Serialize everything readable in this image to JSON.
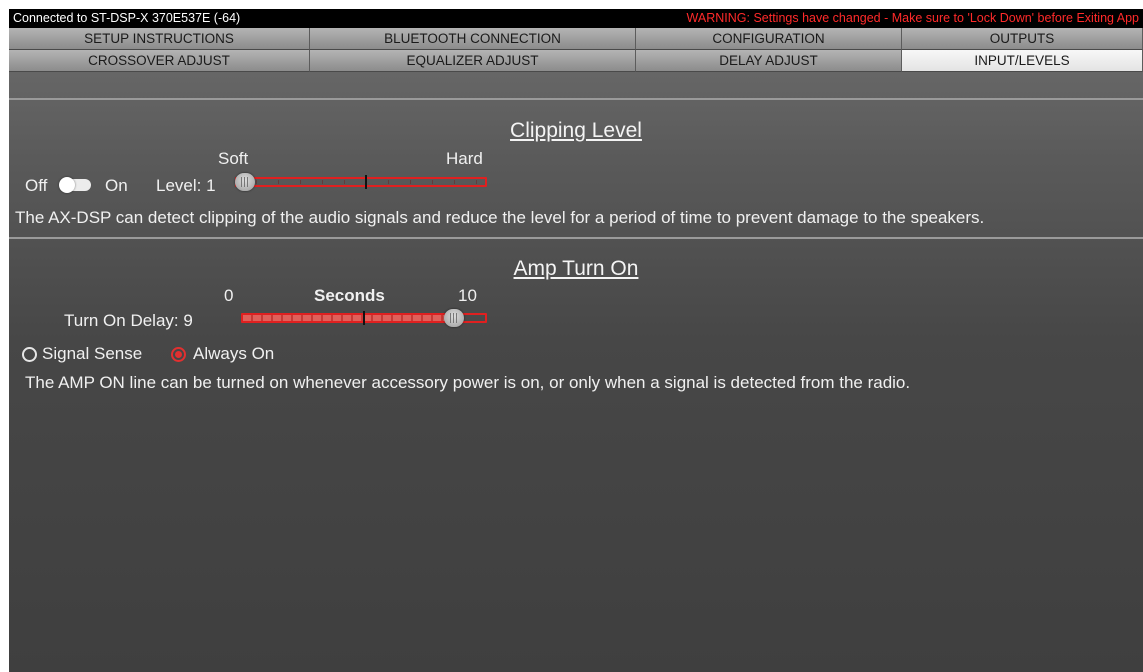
{
  "status": {
    "connection": "Connected to ST-DSP-X  370E537E (-64)",
    "warning": "WARNING: Settings have changed - Make sure to 'Lock Down' before Exiting App",
    "warning_color": "#ff2a2a"
  },
  "tabs_row1": [
    "SETUP INSTRUCTIONS",
    "BLUETOOTH CONNECTION",
    "CONFIGURATION",
    "OUTPUTS"
  ],
  "tabs_row2": [
    "CROSSOVER ADJUST",
    "EQUALIZER ADJUST",
    "DELAY ADJUST",
    "INPUT/LEVELS"
  ],
  "active_tab": "INPUT/LEVELS",
  "clipping": {
    "title": "Clipping Level",
    "soft_label": "Soft",
    "hard_label": "Hard",
    "off_label": "Off",
    "on_label": "On",
    "level_label": "Level: 1",
    "level_fraction": 0.0,
    "description": "The AX-DSP can detect clipping of the audio signals and reduce the level for a period of time to prevent damage to the speakers."
  },
  "amp": {
    "title": "Amp Turn On",
    "min_label": "0",
    "unit_label": "Seconds",
    "max_label": "10",
    "delay_label": "Turn On Delay: 9",
    "delay_fraction": 0.9,
    "radio_signal": "Signal Sense",
    "radio_always": "Always On",
    "selected": "Always On",
    "description": "The AMP ON line can be turned on whenever accessory power is on, or only when a signal is detected from the radio."
  },
  "accent_color": "#e02020"
}
